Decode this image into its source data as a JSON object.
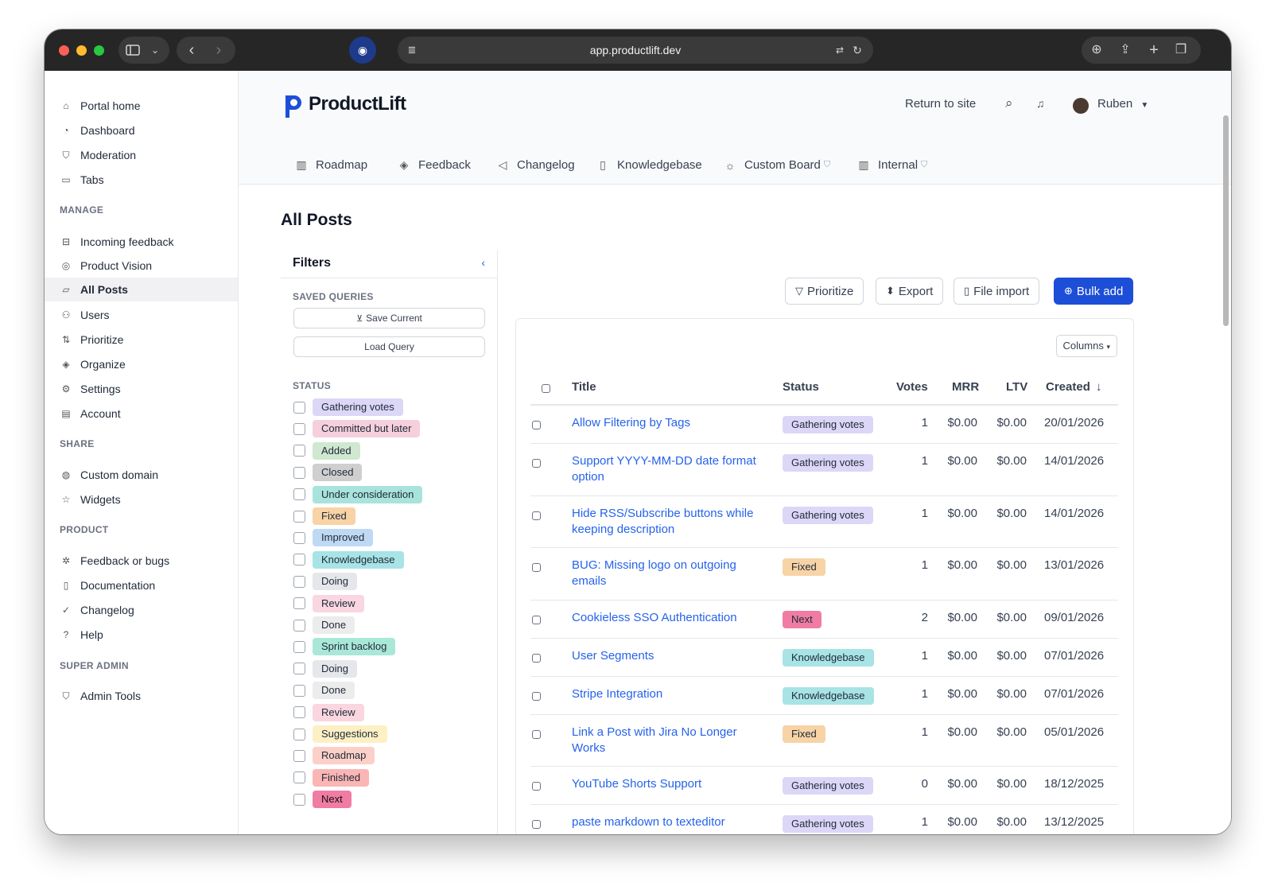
{
  "browser": {
    "url": "app.productlift.dev"
  },
  "sidebar": {
    "top_items": [
      {
        "label": "Portal home",
        "icon": "home-icon"
      },
      {
        "label": "Dashboard",
        "icon": "gauge-icon"
      },
      {
        "label": "Moderation",
        "icon": "shield-icon"
      },
      {
        "label": "Tabs",
        "icon": "folder-icon"
      }
    ],
    "manage_heading": "MANAGE",
    "manage_items": [
      {
        "label": "Incoming feedback",
        "icon": "inbox-icon"
      },
      {
        "label": "Product Vision",
        "icon": "eye-icon"
      },
      {
        "label": "All Posts",
        "icon": "posts-icon",
        "active": true
      },
      {
        "label": "Users",
        "icon": "users-icon"
      },
      {
        "label": "Prioritize",
        "icon": "sort-icon"
      },
      {
        "label": "Organize",
        "icon": "layers-icon"
      },
      {
        "label": "Settings",
        "icon": "gear-icon"
      },
      {
        "label": "Account",
        "icon": "wallet-icon"
      }
    ],
    "share_heading": "SHARE",
    "share_items": [
      {
        "label": "Custom domain",
        "icon": "globe-icon"
      },
      {
        "label": "Widgets",
        "icon": "star-icon"
      }
    ],
    "product_heading": "PRODUCT",
    "product_items": [
      {
        "label": "Feedback or bugs",
        "icon": "bug-icon"
      },
      {
        "label": "Documentation",
        "icon": "book-icon"
      },
      {
        "label": "Changelog",
        "icon": "check-circle-icon"
      },
      {
        "label": "Help",
        "icon": "question-icon"
      }
    ],
    "super_admin_heading": "SUPER ADMIN",
    "super_admin_items": [
      {
        "label": "Admin Tools",
        "icon": "shield-icon"
      }
    ]
  },
  "header": {
    "brand": "ProductLift",
    "return_link": "Return to site",
    "user_name": "Ruben",
    "nav_tabs": [
      {
        "label": "Roadmap",
        "icon": "columns-icon"
      },
      {
        "label": "Feedback",
        "icon": "layers-icon"
      },
      {
        "label": "Changelog",
        "icon": "megaphone-icon"
      },
      {
        "label": "Knowledgebase",
        "icon": "book-icon"
      },
      {
        "label": "Custom Board",
        "icon": "bulb-icon",
        "private": true
      },
      {
        "label": "Internal",
        "icon": "columns-icon",
        "private": true
      }
    ]
  },
  "page": {
    "title": "All Posts"
  },
  "filters": {
    "title": "Filters",
    "saved_queries_heading": "SAVED QUERIES",
    "save_current": "Save Current",
    "load_query": "Load Query",
    "status_heading": "STATUS",
    "statuses": [
      {
        "label": "Gathering votes",
        "color": "#dcd6f7"
      },
      {
        "label": "Committed but later",
        "color": "#f5d0dc"
      },
      {
        "label": "Added",
        "color": "#cfe8cf"
      },
      {
        "label": "Closed",
        "color": "#cfcfcf"
      },
      {
        "label": "Under consideration",
        "color": "#a8e3dc"
      },
      {
        "label": "Fixed",
        "color": "#f7d3a6"
      },
      {
        "label": "Improved",
        "color": "#bfd9f5"
      },
      {
        "label": "Knowledgebase",
        "color": "#a8e3e6"
      },
      {
        "label": "Doing",
        "color": "#e5e7eb"
      },
      {
        "label": "Review",
        "color": "#f9d6e0"
      },
      {
        "label": "Done",
        "color": "#ececec"
      },
      {
        "label": "Sprint backlog",
        "color": "#a9e8d8"
      },
      {
        "label": "Doing",
        "color": "#e5e7eb"
      },
      {
        "label": "Done",
        "color": "#ececec"
      },
      {
        "label": "Review",
        "color": "#f9d6e0"
      },
      {
        "label": "Suggestions",
        "color": "#fdf0c4"
      },
      {
        "label": "Roadmap",
        "color": "#fbd0c8"
      },
      {
        "label": "Finished",
        "color": "#fab5b5"
      },
      {
        "label": "Next",
        "color": "#f07ca3"
      }
    ]
  },
  "toolbar": {
    "prioritize": "Prioritize",
    "export": "Export",
    "file_import": "File import",
    "bulk_add": "Bulk add"
  },
  "table": {
    "columns_button": "Columns",
    "headers": {
      "title": "Title",
      "status": "Status",
      "votes": "Votes",
      "mrr": "MRR",
      "ltv": "LTV",
      "created": "Created"
    },
    "rows": [
      {
        "title": "Allow Filtering by Tags",
        "status": "Gathering votes",
        "status_color": "#dcd6f7",
        "votes": "1",
        "mrr": "$0.00",
        "ltv": "$0.00",
        "created": "20/01/2026"
      },
      {
        "title": "Support YYYY-MM-DD date format option",
        "status": "Gathering votes",
        "status_color": "#dcd6f7",
        "votes": "1",
        "mrr": "$0.00",
        "ltv": "$0.00",
        "created": "14/01/2026"
      },
      {
        "title": "Hide RSS/Subscribe buttons while keeping description",
        "status": "Gathering votes",
        "status_color": "#dcd6f7",
        "votes": "1",
        "mrr": "$0.00",
        "ltv": "$0.00",
        "created": "14/01/2026"
      },
      {
        "title": "BUG: Missing logo on outgoing emails",
        "status": "Fixed",
        "status_color": "#f7d3a6",
        "votes": "1",
        "mrr": "$0.00",
        "ltv": "$0.00",
        "created": "13/01/2026"
      },
      {
        "title": "Cookieless SSO Authentication",
        "status": "Next",
        "status_color": "#f07ca3",
        "votes": "2",
        "mrr": "$0.00",
        "ltv": "$0.00",
        "created": "09/01/2026"
      },
      {
        "title": "User Segments",
        "status": "Knowledgebase",
        "status_color": "#a8e3e6",
        "votes": "1",
        "mrr": "$0.00",
        "ltv": "$0.00",
        "created": "07/01/2026"
      },
      {
        "title": "Stripe Integration",
        "status": "Knowledgebase",
        "status_color": "#a8e3e6",
        "votes": "1",
        "mrr": "$0.00",
        "ltv": "$0.00",
        "created": "07/01/2026"
      },
      {
        "title": "Link a Post with Jira No Longer Works",
        "status": "Fixed",
        "status_color": "#f7d3a6",
        "votes": "1",
        "mrr": "$0.00",
        "ltv": "$0.00",
        "created": "05/01/2026"
      },
      {
        "title": "YouTube Shorts Support",
        "status": "Gathering votes",
        "status_color": "#dcd6f7",
        "votes": "0",
        "mrr": "$0.00",
        "ltv": "$0.00",
        "created": "18/12/2025"
      },
      {
        "title": "paste markdown to texteditor",
        "status": "Gathering votes",
        "status_color": "#dcd6f7",
        "votes": "1",
        "mrr": "$0.00",
        "ltv": "$0.00",
        "created": "13/12/2025"
      }
    ]
  }
}
